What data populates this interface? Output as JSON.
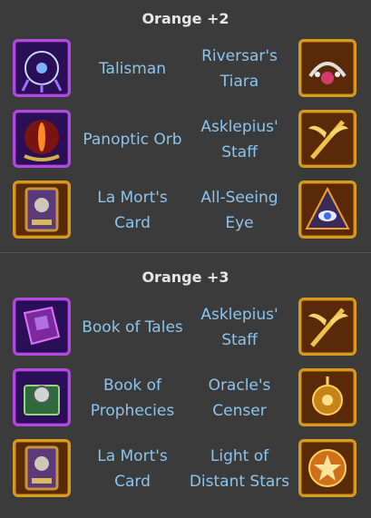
{
  "sections": [
    {
      "title": "Orange +2",
      "rows": [
        {
          "left": {
            "name": "Talisman",
            "icon": "talisman-icon",
            "frame": "purple"
          },
          "right": {
            "name_lines": [
              "Riversar's",
              "Tiara"
            ],
            "icon": "tiara-icon",
            "frame": "gold"
          }
        },
        {
          "left": {
            "name": "Panoptic Orb",
            "icon": "orb-icon",
            "frame": "purple"
          },
          "right": {
            "name_lines": [
              "Asklepius'",
              "Staff"
            ],
            "icon": "staff-icon",
            "frame": "gold"
          }
        },
        {
          "left": {
            "name_lines": [
              "La Mort's",
              "Card"
            ],
            "icon": "card-icon",
            "frame": "gold"
          },
          "right": {
            "name_lines": [
              "All-Seeing",
              "Eye"
            ],
            "icon": "eye-icon",
            "frame": "gold"
          }
        }
      ]
    },
    {
      "title": "Orange +3",
      "rows": [
        {
          "left": {
            "name": "Book of Tales",
            "icon": "book-icon",
            "frame": "purple"
          },
          "right": {
            "name_lines": [
              "Asklepius'",
              "Staff"
            ],
            "icon": "staff-icon",
            "frame": "gold"
          }
        },
        {
          "left": {
            "name_lines": [
              "Book of",
              "Prophecies"
            ],
            "icon": "prophecies-book-icon",
            "frame": "purple"
          },
          "right": {
            "name_lines": [
              "Oracle's",
              "Censer"
            ],
            "icon": "censer-icon",
            "frame": "gold"
          }
        },
        {
          "left": {
            "name_lines": [
              "La Mort's",
              "Card"
            ],
            "icon": "card-icon",
            "frame": "gold"
          },
          "right": {
            "name_lines": [
              "Light of",
              "Distant Stars"
            ],
            "icon": "stars-icon",
            "frame": "gold"
          }
        }
      ]
    }
  ],
  "colors": {
    "label": "#8cc4ee",
    "purple_frame": "#b14be0",
    "gold_frame": "#d99a1c",
    "background": "#3b3b3b"
  }
}
